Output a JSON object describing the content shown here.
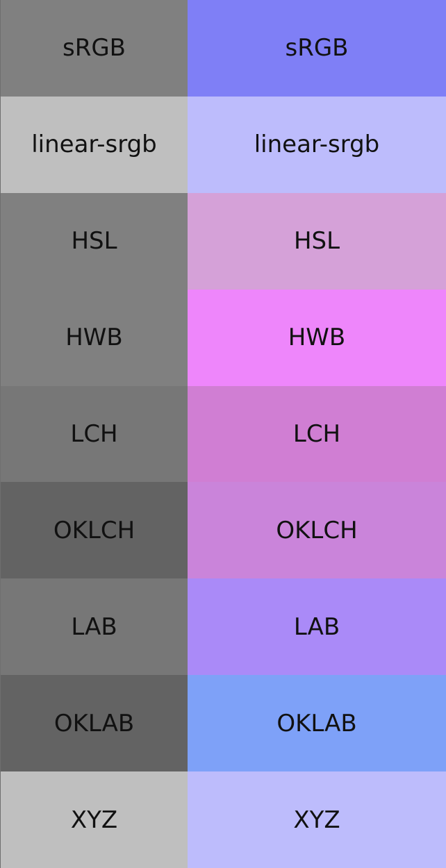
{
  "rows": [
    {
      "label": "sRGB",
      "left_color": "#808080",
      "right_color": "#7f7ff6"
    },
    {
      "label": "linear-srgb",
      "left_color": "#bfbfbf",
      "right_color": "#bdbcfc"
    },
    {
      "label": "HSL",
      "left_color": "#808080",
      "right_color": "#d5a1d8"
    },
    {
      "label": "HWB",
      "left_color": "#808080",
      "right_color": "#ee86fb"
    },
    {
      "label": "LCH",
      "left_color": "#777777",
      "right_color": "#d07ed3"
    },
    {
      "label": "OKLCH",
      "left_color": "#636363",
      "right_color": "#ca84da"
    },
    {
      "label": "LAB",
      "left_color": "#777777",
      "right_color": "#aa8af8"
    },
    {
      "label": "OKLAB",
      "left_color": "#636363",
      "right_color": "#7ea1f8"
    },
    {
      "label": "XYZ",
      "left_color": "#bfbfbf",
      "right_color": "#bdbcfc"
    }
  ]
}
